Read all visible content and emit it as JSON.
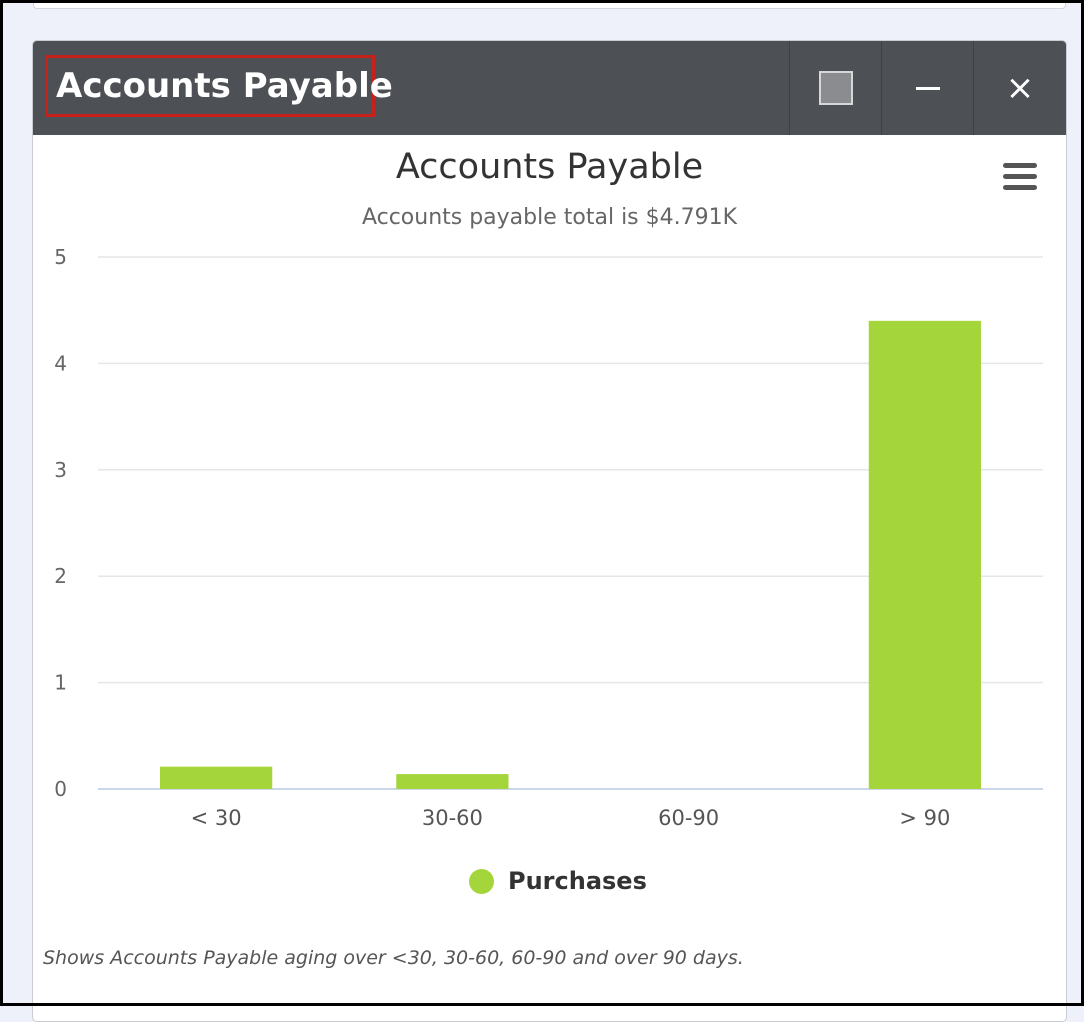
{
  "widget": {
    "header_title": "Accounts Payable",
    "maximize_icon": "maximize-icon",
    "minimize_icon": "minimize-icon",
    "close_icon": "close-icon",
    "close_glyph": "×",
    "menu_icon": "hamburger-menu-icon",
    "footnote": "Shows Accounts Payable aging over <30, 30-60, 60-90 and over 90 days."
  },
  "chart_data": {
    "type": "bar",
    "title": "Accounts Payable",
    "subtitle": "Accounts payable total is $4.791K",
    "categories": [
      "< 30",
      "30-60",
      "60-90",
      "> 90"
    ],
    "series": [
      {
        "name": "Purchases",
        "values": [
          0.21,
          0.14,
          0,
          4.4
        ],
        "color": "#a4d53a"
      }
    ],
    "y_ticks": [
      0,
      1,
      2,
      3,
      4,
      5
    ],
    "ylim": [
      0,
      5
    ],
    "xlabel": "",
    "ylabel": "",
    "grid": true,
    "legend_position": "bottom-center"
  }
}
